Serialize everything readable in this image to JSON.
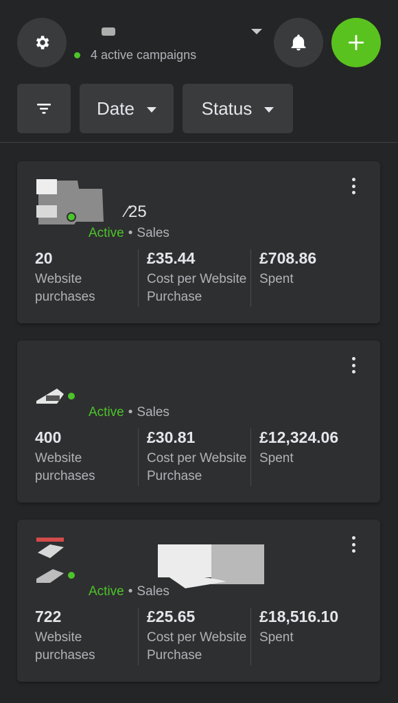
{
  "header": {
    "account_subtitle": "4 active campaigns",
    "icons": {
      "settings": "gear-icon",
      "account_menu": "caret-down-icon",
      "notifications": "bell-icon",
      "create": "plus-icon"
    },
    "colors": {
      "accent": "#5ac21f",
      "active": "#4cc42a",
      "background": "#242526",
      "surface": "#3a3b3c"
    }
  },
  "filters": {
    "filter_icon": "filter-icon",
    "date_label": "Date",
    "status_label": "Status"
  },
  "campaigns": [
    {
      "name_visible": "⁄25",
      "status": "Active",
      "objective": "Sales",
      "results_value": "20",
      "results_label_line1": "Website",
      "results_label_line2": "purchases",
      "cost_value": "£35.44",
      "cost_label_line1": "Cost per Website",
      "cost_label_line2": "Purchase",
      "spent_value": "£708.86",
      "spent_label": "Spent"
    },
    {
      "name_visible": "",
      "status": "Active",
      "objective": "Sales",
      "results_value": "400",
      "results_label_line1": "Website",
      "results_label_line2": "purchases",
      "cost_value": "£30.81",
      "cost_label_line1": "Cost per Website",
      "cost_label_line2": "Purchase",
      "spent_value": "£12,324.06",
      "spent_label": "Spent"
    },
    {
      "name_visible": "",
      "status": "Active",
      "objective": "Sales",
      "results_value": "722",
      "results_label_line1": "Website",
      "results_label_line2": "purchases",
      "cost_value": "£25.65",
      "cost_label_line1": "Cost per Website",
      "cost_label_line2": "Purchase",
      "spent_value": "£18,516.10",
      "spent_label": "Spent"
    }
  ]
}
